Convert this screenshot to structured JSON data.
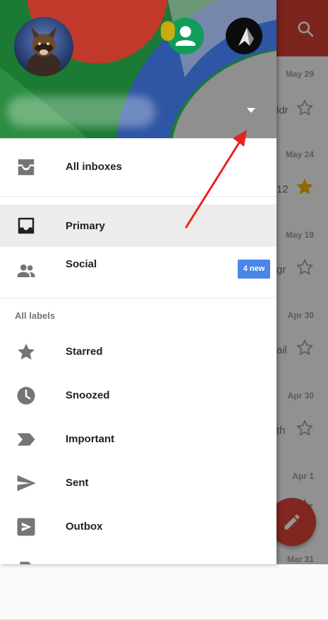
{
  "background": {
    "toolbar_color": "#d23f31",
    "search_icon": "search-icon",
    "rows": [
      {
        "date": "May 29",
        "snippet": "ldr",
        "starred": false
      },
      {
        "date": "May 24",
        "snippet": "12",
        "starred": true
      },
      {
        "date": "May 19",
        "snippet": "gr",
        "starred": false
      },
      {
        "date": "Apr 30",
        "snippet": "ail",
        "starred": false
      },
      {
        "date": "Apr 30",
        "snippet": "th",
        "starred": false
      },
      {
        "date": "Apr 1",
        "snippet": "",
        "starred": false
      },
      {
        "date": "Mar 31",
        "snippet": "",
        "starred": false
      }
    ],
    "fab_icon": "pencil-icon"
  },
  "drawer": {
    "account_switcher_icon": "triangle-down-icon",
    "inboxes": [
      {
        "label": "All inboxes",
        "icon": "all-inboxes-icon"
      },
      {
        "label": "Primary",
        "icon": "inbox-icon",
        "selected": true
      },
      {
        "label": "Social",
        "icon": "people-icon",
        "badge": "4 new"
      }
    ],
    "labels_heading": "All labels",
    "labels": [
      {
        "label": "Starred",
        "icon": "star-icon"
      },
      {
        "label": "Snoozed",
        "icon": "clock-icon"
      },
      {
        "label": "Important",
        "icon": "important-icon"
      },
      {
        "label": "Sent",
        "icon": "send-icon"
      },
      {
        "label": "Outbox",
        "icon": "outbox-icon"
      }
    ]
  },
  "colors": {
    "accent_red": "#db4437",
    "badge_blue": "#4a86e8",
    "selected_row": "#ececec",
    "star_gold": "#f4b400"
  }
}
